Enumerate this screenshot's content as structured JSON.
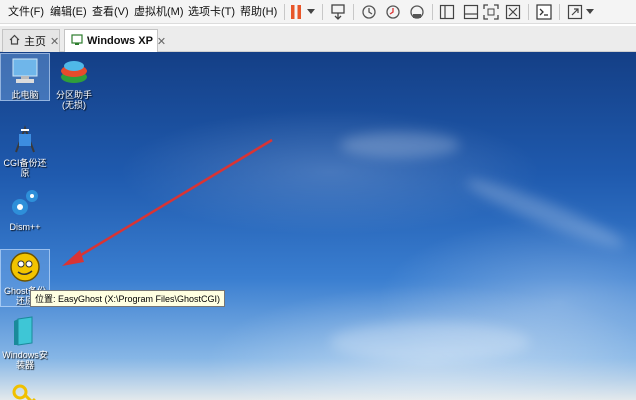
{
  "menu": [
    "文件(F)",
    "编辑(E)",
    "查看(V)",
    "虚拟机(M)",
    "选项卡(T)",
    "帮助(H)"
  ],
  "toolbar_icons": [
    "pause-icon",
    "dropdown-icon",
    "send-keys-icon",
    "snapshot-icon",
    "snapshot-revert-icon",
    "snapshot-manager-icon",
    "sidebar-icon",
    "thumbnail-icon",
    "fullscreen-icon",
    "unity-icon",
    "console-icon",
    "stretch-icon"
  ],
  "tabs": {
    "home": "主页",
    "active": "Windows XP",
    "close": "✕"
  },
  "desktop_icons": [
    {
      "label": "此电脑",
      "icon": "computer-icon"
    },
    {
      "label": "分区助手(无损)",
      "icon": "partition-assistant-icon"
    },
    {
      "label": "CGI备份还原",
      "icon": "cgi-backup-icon"
    },
    {
      "label": "Dism++",
      "icon": "dism-gear-icon"
    },
    {
      "label": "Ghost备份还原",
      "icon": "ghost-icon"
    },
    {
      "label": "Windows安装器",
      "icon": "windows-installer-icon"
    },
    {
      "label": "",
      "icon": "key-icon"
    }
  ],
  "tooltip": "位置: EasyGhost (X:\\Program Files\\GhostCGI)",
  "colors": {
    "pause": "#e8562a",
    "arrow": "#d93434",
    "menubar": "#f4f4f4",
    "tooltip_bg": "#ffffe1"
  }
}
